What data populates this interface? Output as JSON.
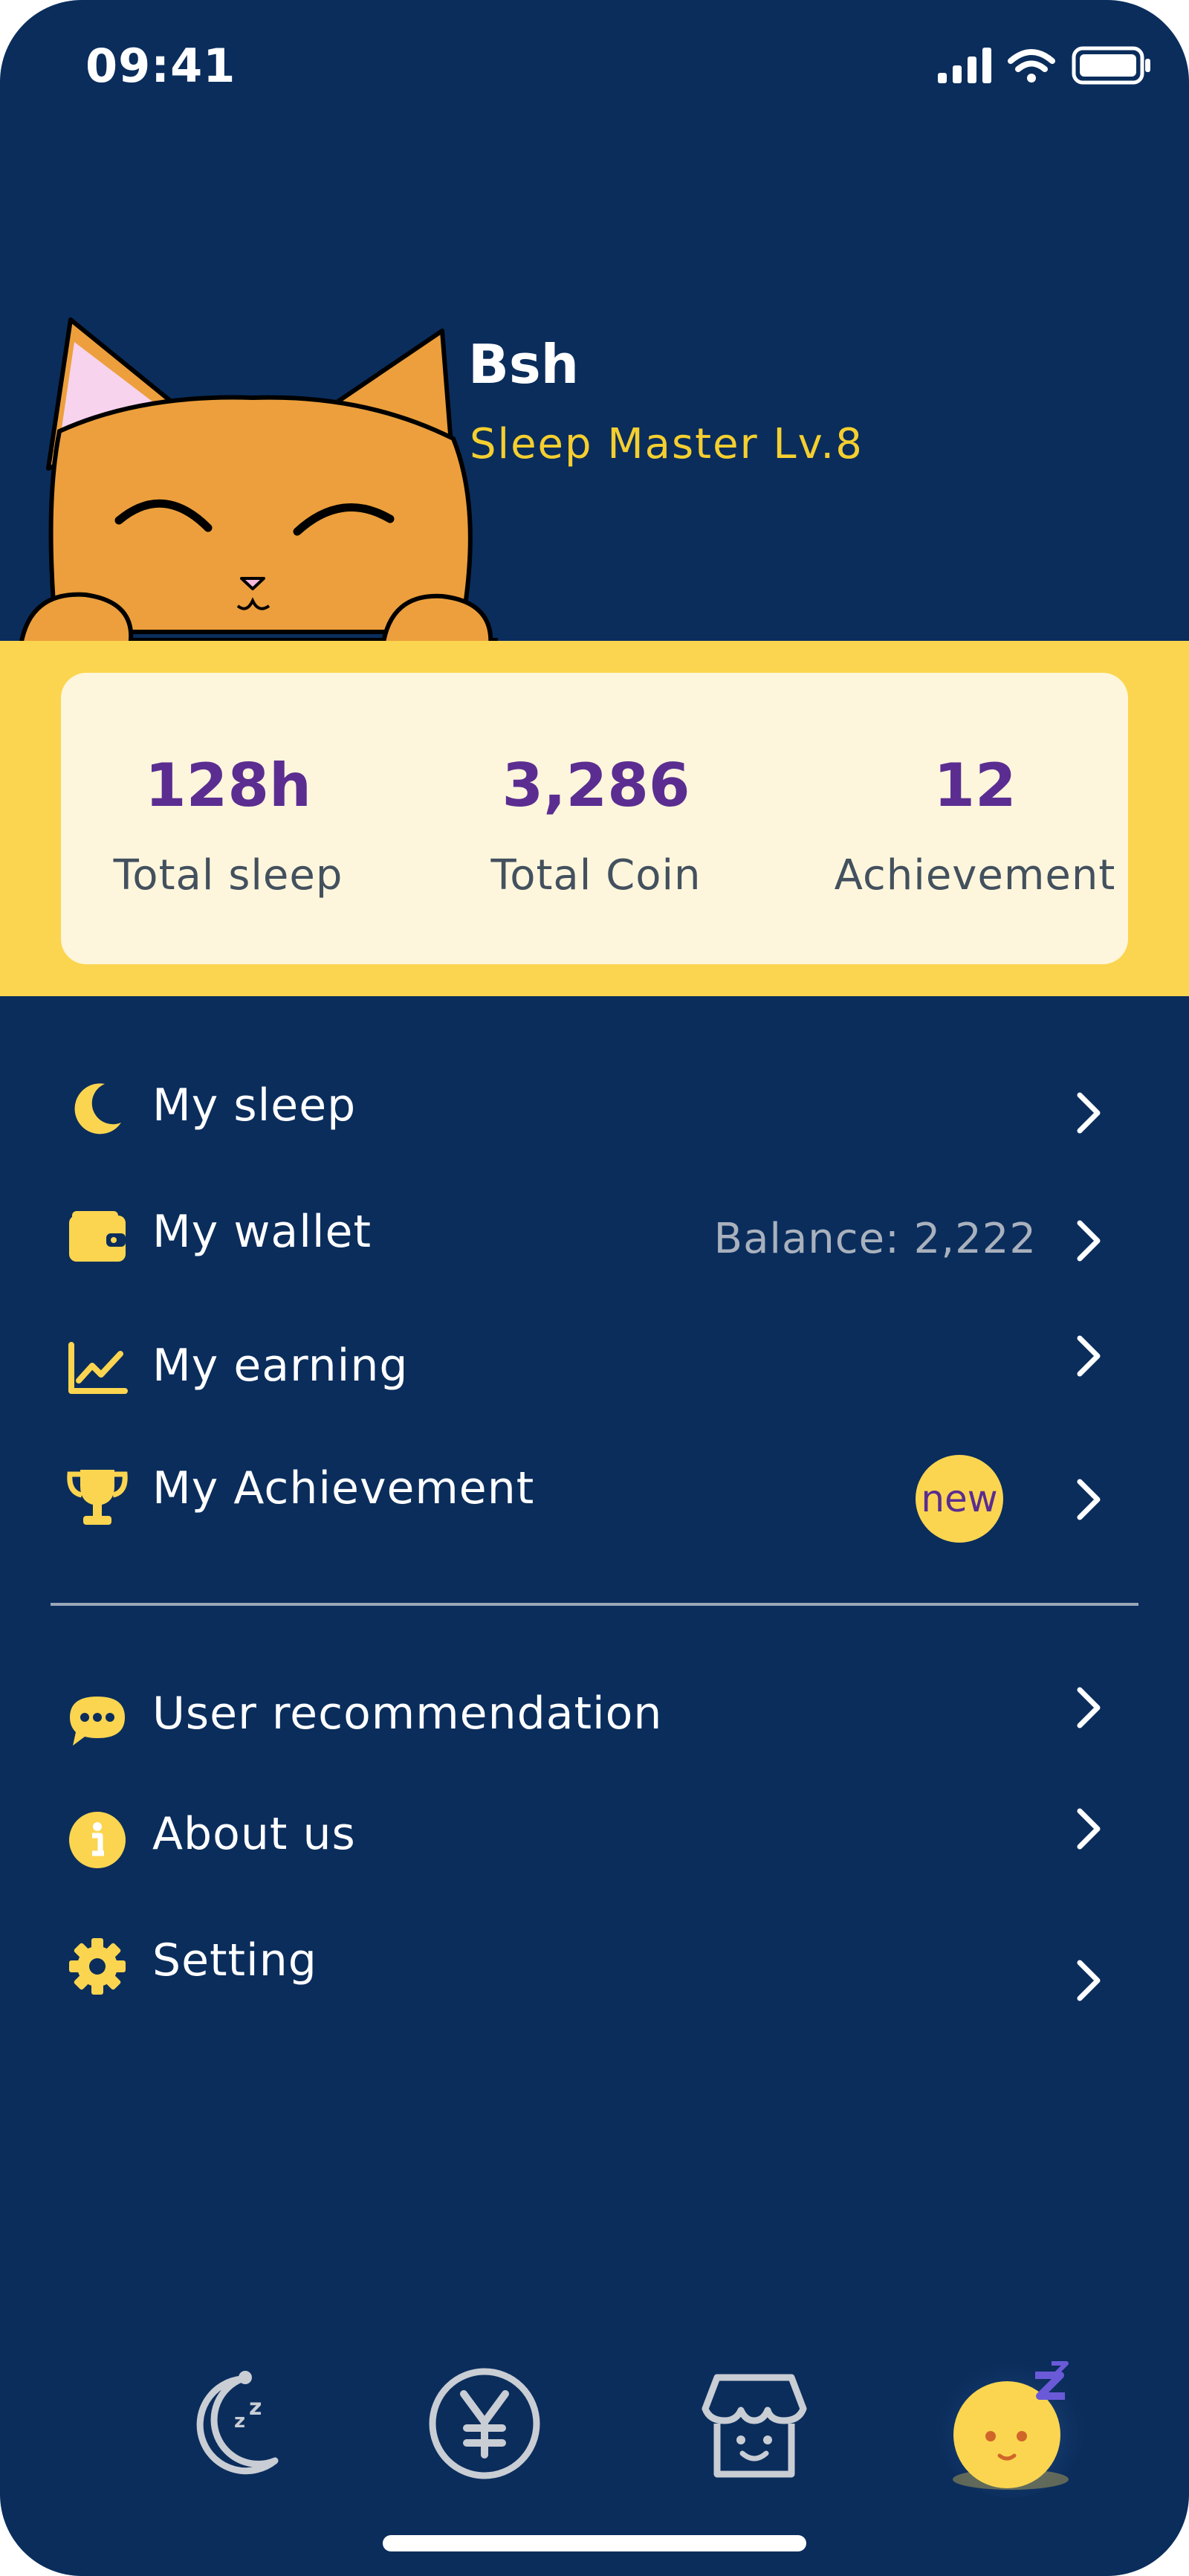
{
  "status_bar": {
    "time": "09:41"
  },
  "profile": {
    "name": "Bsh",
    "level": "Sleep Master Lv.8"
  },
  "stats": [
    {
      "value": "128h",
      "label": "Total sleep"
    },
    {
      "value": "3,286",
      "label": "Total Coin"
    },
    {
      "value": "12",
      "label": "Achievement"
    }
  ],
  "menu": [
    {
      "label": "My sleep",
      "icon": "moon-icon"
    },
    {
      "label": "My wallet",
      "icon": "wallet-icon",
      "extra": "Balance: 2,222"
    },
    {
      "label": "My earning",
      "icon": "chart-line-icon"
    },
    {
      "label": "My Achievement",
      "icon": "trophy-icon",
      "badge": "new"
    }
  ],
  "menu_secondary": [
    {
      "label": "User recommendation",
      "icon": "chat-bubble-icon"
    },
    {
      "label": "About us",
      "icon": "info-icon"
    },
    {
      "label": "Setting",
      "icon": "gear-icon"
    }
  ],
  "tab_bar": [
    {
      "name": "sleep-tab",
      "icon": "moon-zzz-icon"
    },
    {
      "name": "coin-tab",
      "icon": "yen-coin-icon"
    },
    {
      "name": "shop-tab",
      "icon": "shop-icon"
    },
    {
      "name": "profile-tab",
      "icon": "sleepy-face-icon",
      "active": true
    }
  ],
  "colors": {
    "background": "#0a2d5c",
    "accent_yellow": "#fbd54f",
    "level_text": "#f5cf2f",
    "stat_value": "#5b2d91",
    "card": "#fdf6dc"
  }
}
